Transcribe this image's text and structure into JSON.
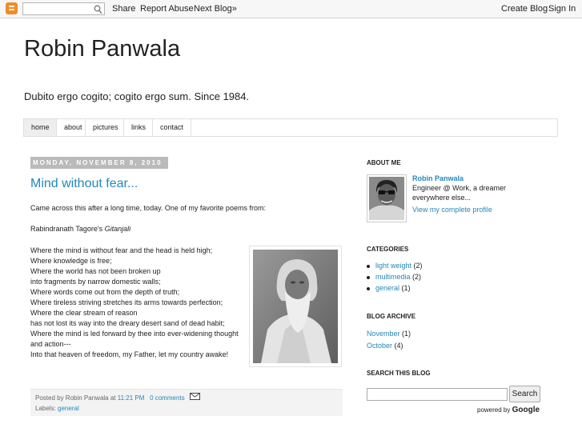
{
  "navbar": {
    "search_placeholder": "",
    "share": "Share",
    "report_abuse": "Report Abuse",
    "next_blog": "Next Blog»",
    "create_blog": "Create Blog",
    "sign_in": "Sign In"
  },
  "header": {
    "title": "Robin Panwala",
    "description": "Dubito ergo cogito; cogito ergo sum. Since 1984."
  },
  "tabs": [
    {
      "label": "home"
    },
    {
      "label": "about"
    },
    {
      "label": "pictures"
    },
    {
      "label": "links"
    },
    {
      "label": "contact"
    }
  ],
  "post": {
    "date": "MONDAY, NOVEMBER 8, 2010",
    "title": "Mind without fear...",
    "intro": "Came across this after a long time, today. One of my favorite poems from:",
    "attribution_prefix": "Rabindranath Tagore's ",
    "attribution_book": "Gitanjali",
    "poem": [
      "Where the mind is without fear and the head is held high;",
      "Where knowledge is free;",
      "Where the world has not been broken up",
      "into fragments by narrow domestic walls;",
      "Where words come out from the depth of truth;",
      "Where tireless striving stretches its arms towards perfection;",
      "Where the clear stream of reason",
      "has not lost its way into the dreary desert sand of dead habit;",
      "Where the mind is led forward by thee into ever-widening thought",
      "and action---",
      "Into that heaven of freedom, my Father, let my country awake!"
    ],
    "footer": {
      "posted_by": "Posted by Robin Panwala at ",
      "time": "11:21 PM",
      "comments": "0 comments",
      "labels_prefix": "Labels: ",
      "label": "general"
    }
  },
  "sidebar": {
    "about_heading": "ABOUT ME",
    "profile_name": "Robin Panwala",
    "profile_desc": "Engineer @ Work, a dreamer everywhere else...",
    "profile_link": "View my complete profile",
    "categories_heading": "CATEGORIES",
    "categories": [
      {
        "name": "light weight",
        "count": "(2)"
      },
      {
        "name": "multimedia",
        "count": "(2)"
      },
      {
        "name": "general",
        "count": "(1)"
      }
    ],
    "archive_heading": "BLOG ARCHIVE",
    "archive": [
      {
        "month": "November",
        "count": "(1)"
      },
      {
        "month": "October",
        "count": "(4)"
      }
    ],
    "search_heading": "SEARCH THIS BLOG",
    "search_button": "Search",
    "powered_by": "powered by ",
    "google": "Google"
  },
  "colors": {
    "link": "#2288bb",
    "date_header_bg": "#bababa",
    "blogger_orange": "#f28c28"
  }
}
